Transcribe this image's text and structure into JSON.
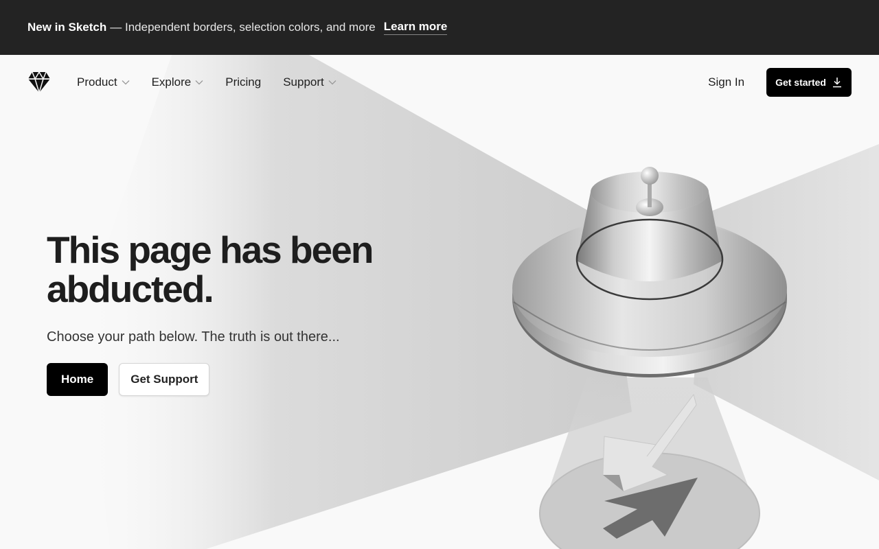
{
  "announcement": {
    "strong": "New in Sketch",
    "rest": "— Independent borders, selection colors, and more",
    "link": "Learn more"
  },
  "nav": {
    "items": [
      {
        "label": "Product",
        "has_menu": true
      },
      {
        "label": "Explore",
        "has_menu": true
      },
      {
        "label": "Pricing",
        "has_menu": false
      },
      {
        "label": "Support",
        "has_menu": true
      }
    ],
    "sign_in": "Sign In",
    "cta": "Get started"
  },
  "hero": {
    "title": "This page has been abducted.",
    "subtitle": "Choose your path below. The truth is out there...",
    "primary": "Home",
    "secondary": "Get Support"
  },
  "icons": {
    "logo": "sketch-diamond-icon",
    "chevron": "chevron-down-icon",
    "download": "download-icon"
  },
  "colors": {
    "announcement_bg": "#232323",
    "page_bg": "#f9f9f9",
    "primary": "#000000"
  }
}
